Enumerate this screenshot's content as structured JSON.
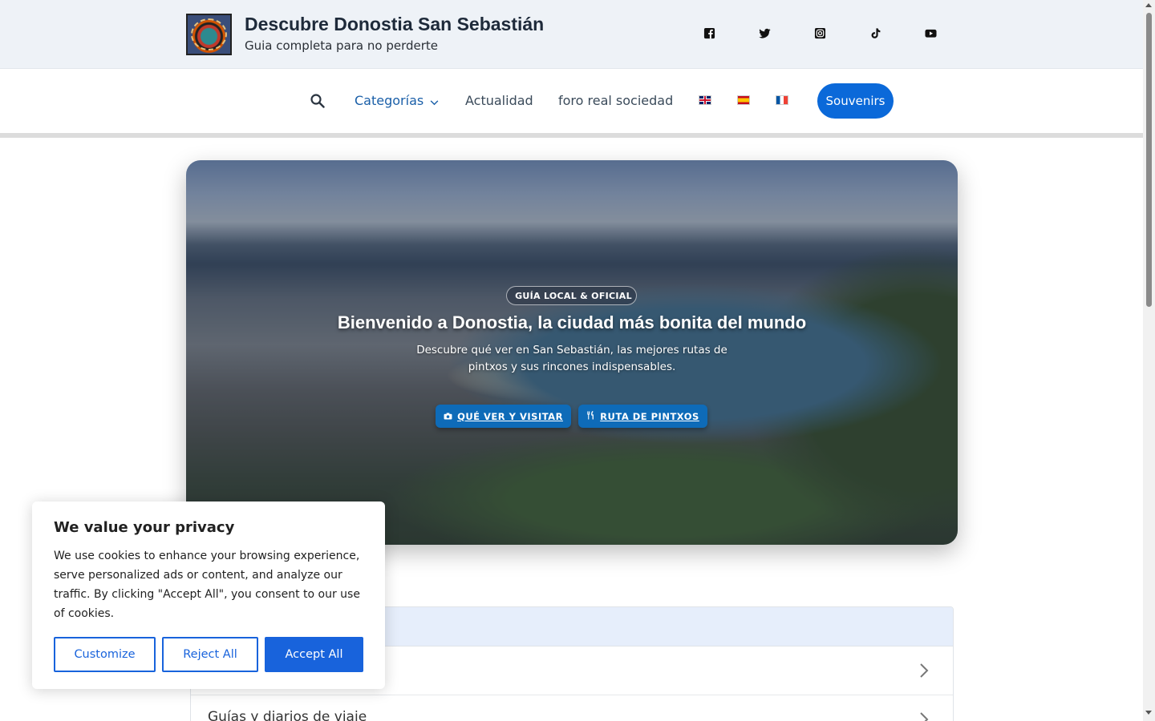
{
  "header": {
    "site_title": "Descubre Donostia San Sebastián",
    "tagline": "Guia completa para no perderte",
    "logo_icon": "site-logo-icon",
    "social": [
      {
        "name": "facebook-icon"
      },
      {
        "name": "twitter-icon"
      },
      {
        "name": "instagram-icon"
      },
      {
        "name": "tiktok-icon"
      },
      {
        "name": "youtube-icon"
      }
    ]
  },
  "nav": {
    "search_icon": "search-icon",
    "items": [
      {
        "label": "Categorías",
        "has_dropdown": true,
        "active": true
      },
      {
        "label": "Actualidad"
      },
      {
        "label": "foro real sociedad"
      }
    ],
    "flags": [
      {
        "name": "flag-english-icon"
      },
      {
        "name": "flag-spanish-icon"
      },
      {
        "name": "flag-french-icon"
      }
    ],
    "cta_label": "Souvenirs"
  },
  "hero": {
    "badge_icon": "",
    "badge_text": "GUÍA LOCAL & OFICIAL",
    "title": "Bienvenido a Donostia, la ciudad más bonita del mundo",
    "subtitle": "Descubre qué ver en San Sebastián, las mejores rutas de pintxos y sus rincones indispensables.",
    "buttons": [
      {
        "label": "QUÉ VER Y VISITAR",
        "icon": "camera-icon"
      },
      {
        "label": "RUTA DE PINTXOS",
        "icon": "utensils-icon"
      }
    ]
  },
  "list": {
    "rows": [
      {
        "label": ""
      },
      {
        "label": "Guías y diarios de viaje"
      }
    ]
  },
  "cookie": {
    "title": "We value your privacy",
    "text": "We use cookies to enhance your browsing experience, serve personalized ads or content, and analyze our traffic. By clicking \"Accept All\", you consent to our use of cookies.",
    "customize": "Customize",
    "reject": "Reject All",
    "accept": "Accept All"
  },
  "colors": {
    "accent": "#0b69d9",
    "cookie_accent": "#1863dc",
    "nav_active": "#1a5fa8"
  }
}
